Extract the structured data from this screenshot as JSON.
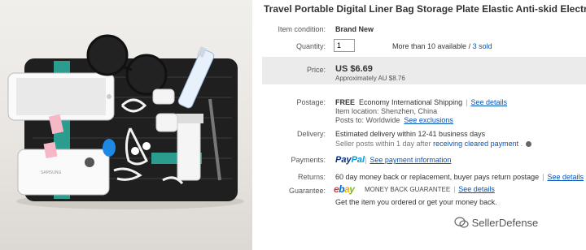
{
  "listing": {
    "title": "Travel Portable Digital Liner Bag Storage Plate Elastic Anti-skid Electronic I"
  },
  "condition": {
    "label": "Item condition:",
    "value": "Brand New"
  },
  "quantity": {
    "label": "Quantity:",
    "value": "1",
    "available": "More than 10 available",
    "sold": "3 sold"
  },
  "price": {
    "label": "Price:",
    "value": "US $6.69",
    "approx": "Approximately AU $8.76"
  },
  "postage": {
    "label": "Postage:",
    "free": "FREE",
    "service": "Economy International Shipping",
    "details_link": "See details",
    "location": "Item location: Shenzhen, China",
    "posts_to": "Posts to: Worldwide",
    "exclusions_link": "See exclusions"
  },
  "delivery": {
    "label": "Delivery:",
    "estimate": "Estimated delivery within 12-41 business days",
    "dispatch": "Seller posts within 1 day after",
    "dispatch_link": "receiving cleared payment"
  },
  "payments": {
    "label": "Payments:",
    "logo": "PayPal",
    "link": "See payment information"
  },
  "returns": {
    "label": "Returns:",
    "text": "60 day money back or replacement, buyer pays return postage",
    "link": "See details"
  },
  "guarantee": {
    "label": "Guarantee:",
    "logo": "ebay",
    "badge": "MONEY BACK GUARANTEE",
    "link": "See details",
    "text": "Get the item you ordered or get your money back."
  },
  "watermark": "SellerDefense",
  "icons": {
    "clock": "clock-icon",
    "watermark": "wechat-icon"
  },
  "colors": {
    "link": "#0654ba",
    "price_bg": "#ebebeb",
    "paypal_dark": "#003087",
    "paypal_light": "#009cde",
    "strap": "#2a9d8f"
  }
}
